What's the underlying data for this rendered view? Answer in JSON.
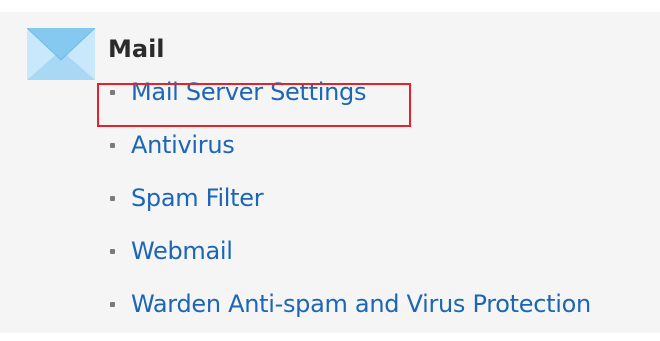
{
  "section": {
    "icon": "mail-envelope-icon",
    "title": "Mail"
  },
  "links": [
    {
      "label": "Mail Server Settings",
      "highlighted": true
    },
    {
      "label": "Antivirus"
    },
    {
      "label": "Spam Filter"
    },
    {
      "label": "Webmail"
    },
    {
      "label": "Warden Anti-spam and Virus Protection"
    }
  ],
  "colors": {
    "link": "#1c66b5",
    "highlight": "#e3232b",
    "icon_light": "#bfe3f8",
    "icon_dark": "#7cc3ec"
  }
}
